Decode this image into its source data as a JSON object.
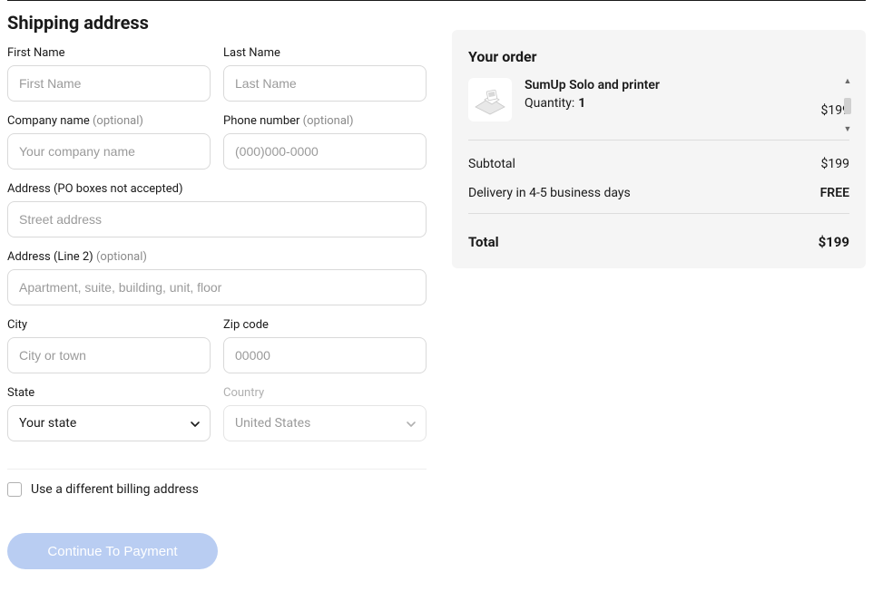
{
  "heading": "Shipping address",
  "fields": {
    "first_name": {
      "label": "First Name",
      "placeholder": "First Name"
    },
    "last_name": {
      "label": "Last Name",
      "placeholder": "Last Name"
    },
    "company": {
      "label": "Company name",
      "optional": "(optional)",
      "placeholder": "Your company name"
    },
    "phone": {
      "label": "Phone number",
      "optional": "(optional)",
      "placeholder": "(000)000-0000"
    },
    "address": {
      "label": "Address (PO boxes not accepted)",
      "placeholder": "Street address"
    },
    "address2": {
      "label": "Address (Line 2)",
      "optional": "(optional)",
      "placeholder": "Apartment, suite, building, unit, floor"
    },
    "city": {
      "label": "City",
      "placeholder": "City or town"
    },
    "zip": {
      "label": "Zip code",
      "placeholder": "00000"
    },
    "state": {
      "label": "State",
      "value": "Your state"
    },
    "country": {
      "label": "Country",
      "value": "United States"
    }
  },
  "billing_checkbox_label": "Use a different billing address",
  "continue_label": "Continue To Payment",
  "order": {
    "title": "Your order",
    "product": {
      "name": "SumUp Solo and printer",
      "qty_label": "Quantity:",
      "qty": "1",
      "price": "$199"
    },
    "subtotal_label": "Subtotal",
    "subtotal_value": "$199",
    "delivery_label": "Delivery in 4-5 business days",
    "delivery_value": "FREE",
    "total_label": "Total",
    "total_value": "$199"
  }
}
